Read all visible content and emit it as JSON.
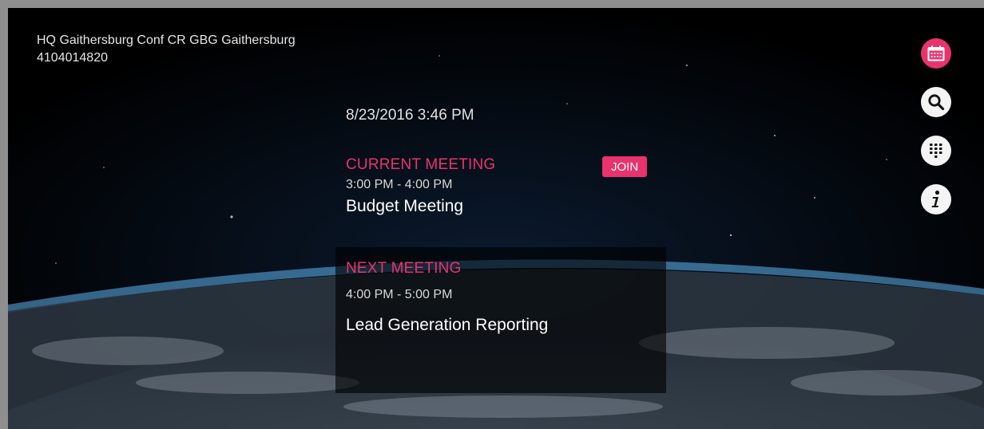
{
  "room": {
    "name": "HQ Gaithersburg Conf CR GBG Gaithersburg",
    "phone": "4104014820"
  },
  "datetime": "8/23/2016 3:46 PM",
  "current_meeting": {
    "label": "CURRENT MEETING",
    "time": "3:00 PM - 4:00 PM",
    "title": "Budget Meeting",
    "join_label": "JOIN"
  },
  "next_meeting": {
    "label": "NEXT MEETING",
    "time": "4:00 PM - 5:00 PM",
    "title": "Lead Generation Reporting"
  },
  "side_nav": [
    {
      "icon": "calendar-icon",
      "active": true
    },
    {
      "icon": "search-icon",
      "active": false
    },
    {
      "icon": "dialpad-icon",
      "active": false
    },
    {
      "icon": "info-icon",
      "active": false
    }
  ],
  "colors": {
    "accent": "#e8336e",
    "text": "#ffffff",
    "button_bg": "#f4f4f4"
  }
}
